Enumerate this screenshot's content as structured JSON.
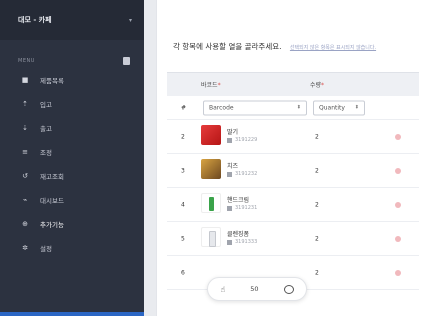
{
  "sidebar": {
    "store_name": "대모 - 카페",
    "section_label": "MENU",
    "items": [
      {
        "label": "제품목록",
        "icon": "box-icon"
      },
      {
        "label": "입고",
        "icon": "upload-icon"
      },
      {
        "label": "출고",
        "icon": "download-icon"
      },
      {
        "label": "조정",
        "icon": "adjust-icon"
      },
      {
        "label": "재고조회",
        "icon": "history-icon"
      },
      {
        "label": "대시보드",
        "icon": "chart-icon"
      },
      {
        "label": "추가기능",
        "icon": "plus-circle-icon"
      },
      {
        "label": "설정",
        "icon": "gear-icon"
      }
    ],
    "active_index": 6
  },
  "main": {
    "instruction": "각 항목에 사용할 열을 골라주세요.",
    "instruction_sub": "선택되지 않은 항목은 표시되지 않습니다.",
    "table": {
      "headers": {
        "barcode": "바코드",
        "qty": "수량",
        "required": "*"
      },
      "mapping_row": {
        "index": "#",
        "barcode_select": "Barcode",
        "qty_select": "Quantity"
      },
      "rows": [
        {
          "index": "2",
          "name": "딸기",
          "code": "3191229",
          "qty": "2",
          "thumb": "t-red"
        },
        {
          "index": "3",
          "name": "치즈",
          "code": "3191232",
          "qty": "2",
          "thumb": "t-brown"
        },
        {
          "index": "4",
          "name": "핸드크림",
          "code": "3191231",
          "qty": "2",
          "thumb": "t-green"
        },
        {
          "index": "5",
          "name": "클렌징폼",
          "code": "3191333",
          "qty": "2",
          "thumb": "t-white"
        },
        {
          "index": "6",
          "name": "",
          "code": "",
          "qty": "2",
          "thumb": ""
        }
      ]
    }
  },
  "floatbar": {
    "count": "50"
  },
  "colors": {
    "sidebar_bg": "#2c3240",
    "accent": "#2b66c4",
    "delete": "#f1b9bd"
  }
}
